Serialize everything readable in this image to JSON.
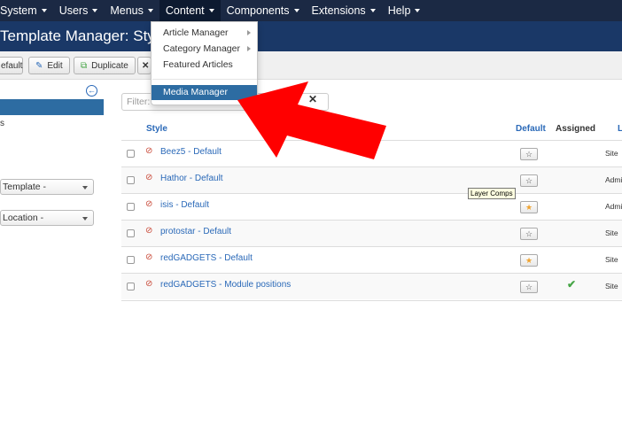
{
  "nav": {
    "items": [
      "System",
      "Users",
      "Menus",
      "Content",
      "Components",
      "Extensions",
      "Help"
    ]
  },
  "title": "Template Manager: Styles",
  "toolbar": {
    "default_label": "efault",
    "edit_label": "Edit",
    "duplicate_label": "Duplicate"
  },
  "sidebar": {
    "item2": "s",
    "template_select": "Template -",
    "location_select": "Location -"
  },
  "filter": {
    "placeholder": "Filter:"
  },
  "table": {
    "headers": {
      "style": "Style",
      "default": "Default",
      "assigned": "Assigned",
      "location": "L"
    },
    "rows": [
      {
        "style": "Beez5 - Default",
        "location": "Site",
        "home": false,
        "assigned": false
      },
      {
        "style": "Hathor - Default",
        "location": "Admi",
        "home": false,
        "assigned": false
      },
      {
        "style": "isis - Default",
        "location": "Admi",
        "home": true,
        "assigned": false
      },
      {
        "style": "protostar - Default",
        "location": "Site",
        "home": false,
        "assigned": false
      },
      {
        "style": "redGADGETS - Default",
        "location": "Site",
        "home": true,
        "assigned": false
      },
      {
        "style": "redGADGETS - Module positions",
        "location": "Site",
        "home": false,
        "assigned": true
      }
    ]
  },
  "dropdown": {
    "items": [
      "Article Manager",
      "Category Manager",
      "Featured Articles",
      "Media Manager"
    ]
  },
  "tooltip": "Layer Comps",
  "colors": {
    "topbar": "#1b2944",
    "titlebar": "#1a3867",
    "link": "#2a69b8",
    "highlight": "#2d6ca2",
    "annotation_arrow": "#ff0000"
  }
}
